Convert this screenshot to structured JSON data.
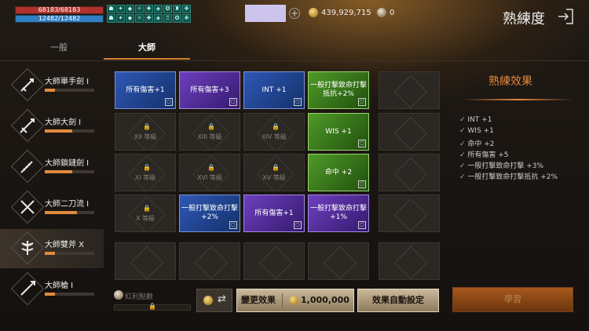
{
  "hud": {
    "hp": "68183/68183",
    "mp": "12482/12482",
    "buffs": [
      "☗",
      "✦",
      "◆",
      "✧",
      "✚",
      "◈",
      "✪",
      "♜",
      "✥",
      "☗",
      "✦",
      "◆",
      "✧",
      "✚",
      "◈",
      "♖",
      "✪",
      "✥"
    ],
    "gold": "439,929,715",
    "silver": "0",
    "title": "熟練度",
    "accent": "#e3873a"
  },
  "tabs": {
    "general": "一般",
    "master": "大師"
  },
  "weapons": [
    {
      "name": "大師單手劍 Ⅰ",
      "progress": 0.2,
      "icon": "sword-icon"
    },
    {
      "name": "大師大劍 Ⅰ",
      "progress": 0.55,
      "icon": "greatsword-icon"
    },
    {
      "name": "大師鎖鏈劍 Ⅰ",
      "progress": 0.55,
      "icon": "chain-sword-icon"
    },
    {
      "name": "大師二刀流 Ⅰ",
      "progress": 0.65,
      "icon": "dual-blades-icon"
    },
    {
      "name": "大師雙斧 Ⅹ",
      "progress": 0.2,
      "icon": "double-axe-icon"
    },
    {
      "name": "大師槍 Ⅰ",
      "progress": 0.2,
      "icon": "spear-icon"
    }
  ],
  "grid": [
    [
      {
        "state": "blue",
        "text": "所有傷害+1"
      },
      {
        "state": "purple",
        "text": "所有傷害+3"
      },
      {
        "state": "blue",
        "text": "INT +1"
      },
      {
        "state": "green",
        "text": "一般打擊致命打擊抵抗+2%"
      },
      {
        "state": "empty"
      }
    ],
    [
      {
        "state": "locked",
        "text": "XII 等級"
      },
      {
        "state": "locked",
        "text": "XIII 等級"
      },
      {
        "state": "locked",
        "text": "XIV 等級"
      },
      {
        "state": "green",
        "text": "WIS +1"
      },
      {
        "state": "empty"
      }
    ],
    [
      {
        "state": "locked",
        "text": "XI 等級"
      },
      {
        "state": "locked",
        "text": "XVI 等級"
      },
      {
        "state": "locked",
        "text": "XV 等級"
      },
      {
        "state": "green",
        "text": "命中 +2"
      },
      {
        "state": "empty"
      }
    ],
    [
      {
        "state": "locked",
        "text": "X 等級"
      },
      {
        "state": "blue",
        "text": "一般打擊致命打擊+2%"
      },
      {
        "state": "purple",
        "text": "所有傷害+1"
      },
      {
        "state": "purple",
        "text": "一般打擊致命打擊+1%"
      },
      {
        "state": "empty"
      }
    ],
    [
      {
        "state": "empty"
      },
      {
        "state": "empty"
      },
      {
        "state": "empty"
      },
      {
        "state": "empty"
      },
      {
        "state": "empty"
      }
    ]
  ],
  "effects": {
    "title": "熟練效果",
    "items": [
      "INT +1",
      "WIS +1",
      "命中 +2",
      "所有傷害 +5",
      "一般打擊致命打擊 +3%",
      "一般打擊致命打擊抵抗 +2%"
    ]
  },
  "bottom": {
    "bonus_label": "紅利點數",
    "change_label": "變更效果",
    "change_cost": "1,000,000",
    "auto_label": "效果自動設定",
    "learn_label": "學習"
  }
}
